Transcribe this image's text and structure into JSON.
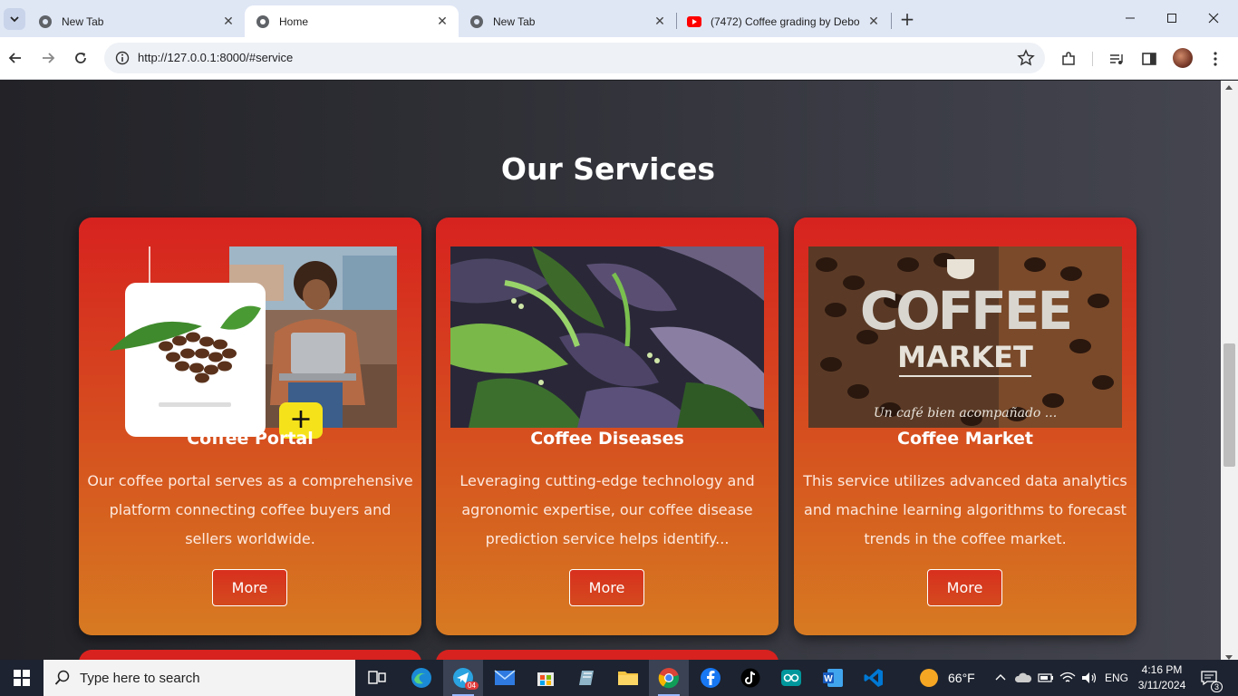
{
  "browser": {
    "tabs": [
      {
        "title": "New Tab",
        "icon": "chrome-icon"
      },
      {
        "title": "Home",
        "icon": "globe-icon"
      },
      {
        "title": "New Tab",
        "icon": "chrome-icon"
      },
      {
        "title": "(7472) Coffee grading by Debo",
        "icon": "youtube-icon"
      }
    ],
    "url": "http://127.0.0.1:8000/#service"
  },
  "page": {
    "heading": "Our Services",
    "cards": [
      {
        "title": "Coffee Portal",
        "description": "Our coffee portal serves as a comprehensive platform connecting coffee buyers and sellers worldwide.",
        "button": "More",
        "image": "coffee-portal-image"
      },
      {
        "title": "Coffee Diseases",
        "description": "Leveraging cutting-edge technology and agronomic expertise, our coffee disease prediction service helps identify...",
        "button": "More",
        "image": "coffee-leaves-image"
      },
      {
        "title": "Coffee Market",
        "description": "This service utilizes advanced data analytics and machine learning algorithms to forecast trends in the coffee market.",
        "button": "More",
        "image": "coffee-market-image",
        "image_text_1": "COFFEE",
        "image_text_2": "MARKET",
        "image_text_3": "Un café bien acompañado ..."
      }
    ]
  },
  "taskbar": {
    "search_placeholder": "Type here to search",
    "weather": "66°F",
    "language": "ENG",
    "time": "4:16 PM",
    "date": "3/11/2024",
    "notification_count": "3",
    "telegram_badge": "04"
  },
  "colors": {
    "card_top": "#d7221f",
    "card_bottom": "#d77a22",
    "page_bg": "#2f3036"
  }
}
